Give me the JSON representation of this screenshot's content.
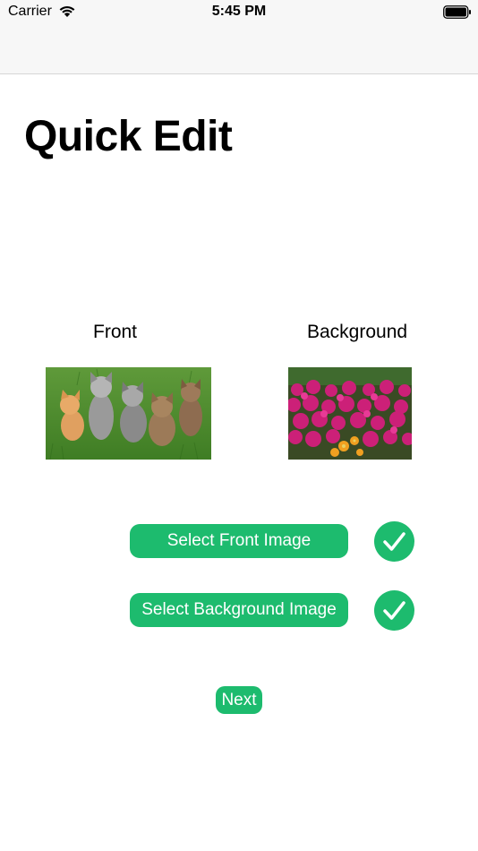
{
  "status_bar": {
    "carrier": "Carrier",
    "time": "5:45 PM",
    "wifi_icon": "wifi-icon",
    "battery_icon": "battery-icon"
  },
  "main": {
    "title": "Quick Edit",
    "front_label": "Front",
    "background_label": "Background",
    "front_image": "kittens-photo",
    "background_image": "flowers-photo",
    "select_front_button": "Select Front Image",
    "select_background_button": "Select Background Image",
    "front_checked": true,
    "background_checked": true,
    "next_button": "Next"
  },
  "colors": {
    "accent": "#1dbb6e",
    "bar_background": "#f7f7f7"
  }
}
